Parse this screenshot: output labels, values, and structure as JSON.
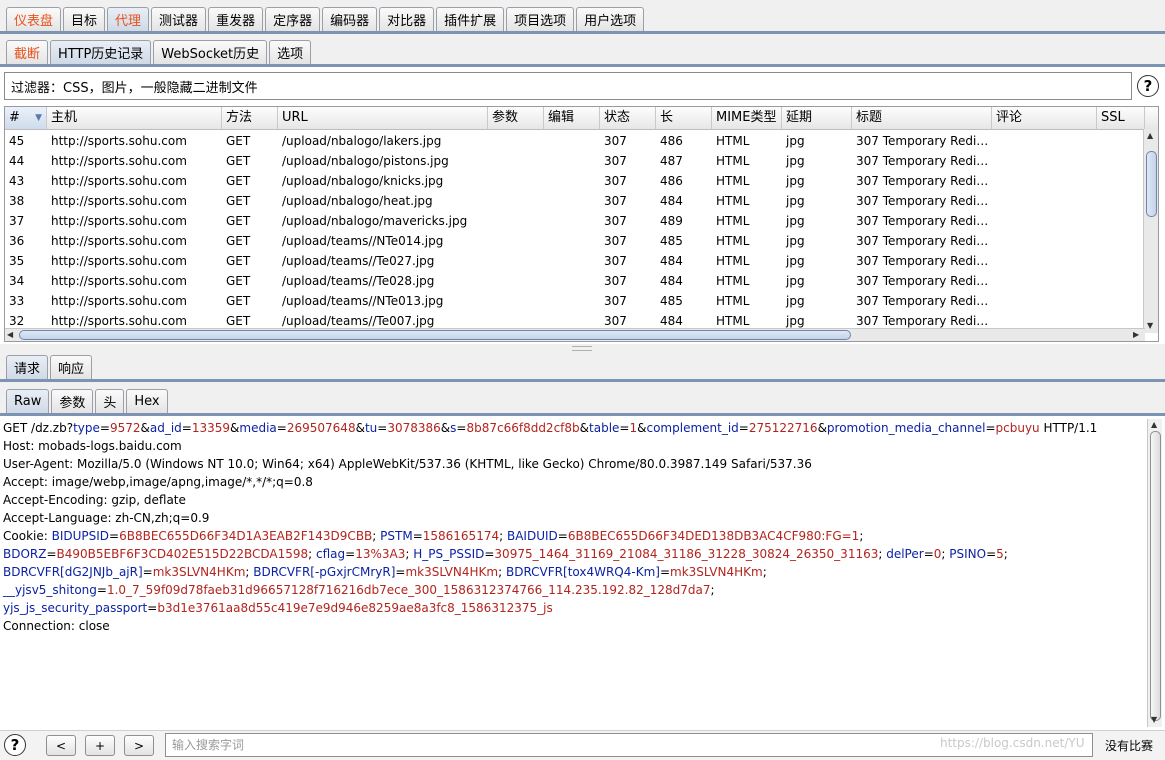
{
  "top_tabs": [
    {
      "label": "仪表盘",
      "style": "orange"
    },
    {
      "label": "目标",
      "style": ""
    },
    {
      "label": "代理",
      "style": "orange active"
    },
    {
      "label": "测试器",
      "style": ""
    },
    {
      "label": "重发器",
      "style": ""
    },
    {
      "label": "定序器",
      "style": ""
    },
    {
      "label": "编码器",
      "style": ""
    },
    {
      "label": "对比器",
      "style": ""
    },
    {
      "label": "插件扩展",
      "style": ""
    },
    {
      "label": "项目选项",
      "style": ""
    },
    {
      "label": "用户选项",
      "style": ""
    }
  ],
  "proxy_tabs": [
    {
      "label": "截断",
      "style": "orange"
    },
    {
      "label": "HTTP历史记录",
      "style": "active"
    },
    {
      "label": "WebSocket历史",
      "style": ""
    },
    {
      "label": "选项",
      "style": ""
    }
  ],
  "filter": {
    "text": "过滤器：CSS，图片，一般隐藏二进制文件"
  },
  "help_symbol": "?",
  "columns": [
    "#",
    "主机",
    "方法",
    "URL",
    "参数",
    "编辑",
    "状态",
    "长",
    "MIME类型",
    "延期",
    "标题",
    "评论",
    "SSL"
  ],
  "sort_arrow": "▼",
  "rows": [
    {
      "num": "45",
      "host": "http://sports.sohu.com",
      "method": "GET",
      "url": "/upload/nbalogo/lakers.jpg",
      "params": "",
      "edited": "",
      "status": "307",
      "length": "486",
      "mime": "HTML",
      "ext": "jpg",
      "title": "307 Temporary Redi…",
      "comment": "",
      "ssl": ""
    },
    {
      "num": "44",
      "host": "http://sports.sohu.com",
      "method": "GET",
      "url": "/upload/nbalogo/pistons.jpg",
      "params": "",
      "edited": "",
      "status": "307",
      "length": "487",
      "mime": "HTML",
      "ext": "jpg",
      "title": "307 Temporary Redi…",
      "comment": "",
      "ssl": ""
    },
    {
      "num": "43",
      "host": "http://sports.sohu.com",
      "method": "GET",
      "url": "/upload/nbalogo/knicks.jpg",
      "params": "",
      "edited": "",
      "status": "307",
      "length": "486",
      "mime": "HTML",
      "ext": "jpg",
      "title": "307 Temporary Redi…",
      "comment": "",
      "ssl": ""
    },
    {
      "num": "38",
      "host": "http://sports.sohu.com",
      "method": "GET",
      "url": "/upload/nbalogo/heat.jpg",
      "params": "",
      "edited": "",
      "status": "307",
      "length": "484",
      "mime": "HTML",
      "ext": "jpg",
      "title": "307 Temporary Redi…",
      "comment": "",
      "ssl": ""
    },
    {
      "num": "37",
      "host": "http://sports.sohu.com",
      "method": "GET",
      "url": "/upload/nbalogo/mavericks.jpg",
      "params": "",
      "edited": "",
      "status": "307",
      "length": "489",
      "mime": "HTML",
      "ext": "jpg",
      "title": "307 Temporary Redi…",
      "comment": "",
      "ssl": ""
    },
    {
      "num": "36",
      "host": "http://sports.sohu.com",
      "method": "GET",
      "url": "/upload/teams//NTe014.jpg",
      "params": "",
      "edited": "",
      "status": "307",
      "length": "485",
      "mime": "HTML",
      "ext": "jpg",
      "title": "307 Temporary Redi…",
      "comment": "",
      "ssl": ""
    },
    {
      "num": "35",
      "host": "http://sports.sohu.com",
      "method": "GET",
      "url": "/upload/teams//Te027.jpg",
      "params": "",
      "edited": "",
      "status": "307",
      "length": "484",
      "mime": "HTML",
      "ext": "jpg",
      "title": "307 Temporary Redi…",
      "comment": "",
      "ssl": ""
    },
    {
      "num": "34",
      "host": "http://sports.sohu.com",
      "method": "GET",
      "url": "/upload/teams//Te028.jpg",
      "params": "",
      "edited": "",
      "status": "307",
      "length": "484",
      "mime": "HTML",
      "ext": "jpg",
      "title": "307 Temporary Redi…",
      "comment": "",
      "ssl": ""
    },
    {
      "num": "33",
      "host": "http://sports.sohu.com",
      "method": "GET",
      "url": "/upload/teams//NTe013.jpg",
      "params": "",
      "edited": "",
      "status": "307",
      "length": "485",
      "mime": "HTML",
      "ext": "jpg",
      "title": "307 Temporary Redi…",
      "comment": "",
      "ssl": ""
    },
    {
      "num": "32",
      "host": "http://sports.sohu.com",
      "method": "GET",
      "url": "/upload/teams//Te007.jpg",
      "params": "",
      "edited": "",
      "status": "307",
      "length": "484",
      "mime": "HTML",
      "ext": "jpg",
      "title": "307 Temporary Redi…",
      "comment": "",
      "ssl": ""
    }
  ],
  "message_tabs": [
    {
      "label": "请求",
      "style": "active"
    },
    {
      "label": "响应",
      "style": ""
    }
  ],
  "view_tabs": [
    {
      "label": "Raw",
      "style": "active"
    },
    {
      "label": "参数",
      "style": ""
    },
    {
      "label": "头",
      "style": ""
    },
    {
      "label": "Hex",
      "style": ""
    }
  ],
  "request_lines": [
    [
      [
        "p",
        "GET /dz.zb?"
      ],
      [
        "k",
        "type"
      ],
      [
        "p",
        "="
      ],
      [
        "v",
        "9572"
      ],
      [
        "p",
        "&"
      ],
      [
        "k",
        "ad_id"
      ],
      [
        "p",
        "="
      ],
      [
        "v",
        "13359"
      ],
      [
        "p",
        "&"
      ],
      [
        "k",
        "media"
      ],
      [
        "p",
        "="
      ],
      [
        "v",
        "269507648"
      ],
      [
        "p",
        "&"
      ],
      [
        "k",
        "tu"
      ],
      [
        "p",
        "="
      ],
      [
        "v",
        "3078386"
      ],
      [
        "p",
        "&"
      ],
      [
        "k",
        "s"
      ],
      [
        "p",
        "="
      ],
      [
        "v",
        "8b87c66f8dd2cf8b"
      ],
      [
        "p",
        "&"
      ],
      [
        "k",
        "table"
      ],
      [
        "p",
        "="
      ],
      [
        "v",
        "1"
      ],
      [
        "p",
        "&"
      ],
      [
        "k",
        "complement_id"
      ],
      [
        "p",
        "="
      ],
      [
        "v",
        "275122716"
      ],
      [
        "p",
        "&"
      ],
      [
        "k",
        "promotion_media_channel"
      ],
      [
        "p",
        "="
      ],
      [
        "v",
        "pcbuyu"
      ],
      [
        "p",
        " HTTP/1.1"
      ]
    ],
    [
      [
        "p",
        "Host: mobads-logs.baidu.com"
      ]
    ],
    [
      [
        "p",
        "User-Agent: Mozilla/5.0 (Windows NT 10.0; Win64; x64) AppleWebKit/537.36 (KHTML, like Gecko) Chrome/80.0.3987.149 Safari/537.36"
      ]
    ],
    [
      [
        "p",
        "Accept: image/webp,image/apng,image/*,*/*;q=0.8"
      ]
    ],
    [
      [
        "p",
        "Accept-Encoding: gzip, deflate"
      ]
    ],
    [
      [
        "p",
        "Accept-Language: zh-CN,zh;q=0.9"
      ]
    ],
    [
      [
        "p",
        "Cookie: "
      ],
      [
        "k",
        "BIDUPSID"
      ],
      [
        "p",
        "="
      ],
      [
        "v",
        "6B8BEC655D66F34D1A3EAB2F143D9CBB"
      ],
      [
        "p",
        "; "
      ],
      [
        "k",
        "PSTM"
      ],
      [
        "p",
        "="
      ],
      [
        "v",
        "1586165174"
      ],
      [
        "p",
        "; "
      ],
      [
        "k",
        "BAIDUID"
      ],
      [
        "p",
        "="
      ],
      [
        "v",
        "6B8BEC655D66F34DED138DB3AC4CF980:FG=1"
      ],
      [
        "p",
        ";"
      ]
    ],
    [
      [
        "k",
        "BDORZ"
      ],
      [
        "p",
        "="
      ],
      [
        "v",
        "B490B5EBF6F3CD402E515D22BCDA1598"
      ],
      [
        "p",
        "; "
      ],
      [
        "k",
        "cflag"
      ],
      [
        "p",
        "="
      ],
      [
        "v",
        "13%3A3"
      ],
      [
        "p",
        "; "
      ],
      [
        "k",
        "H_PS_PSSID"
      ],
      [
        "p",
        "="
      ],
      [
        "v",
        "30975_1464_31169_21084_31186_31228_30824_26350_31163"
      ],
      [
        "p",
        "; "
      ],
      [
        "k",
        "delPer"
      ],
      [
        "p",
        "="
      ],
      [
        "v",
        "0"
      ],
      [
        "p",
        "; "
      ],
      [
        "k",
        "PSINO"
      ],
      [
        "p",
        "="
      ],
      [
        "v",
        "5"
      ],
      [
        "p",
        ";"
      ]
    ],
    [
      [
        "k",
        "BDRCVFR[dG2JNJb_ajR]"
      ],
      [
        "p",
        "="
      ],
      [
        "v",
        "mk3SLVN4HKm"
      ],
      [
        "p",
        "; "
      ],
      [
        "k",
        "BDRCVFR[-pGxjrCMryR]"
      ],
      [
        "p",
        "="
      ],
      [
        "v",
        "mk3SLVN4HKm"
      ],
      [
        "p",
        "; "
      ],
      [
        "k",
        "BDRCVFR[tox4WRQ4-Km]"
      ],
      [
        "p",
        "="
      ],
      [
        "v",
        "mk3SLVN4HKm"
      ],
      [
        "p",
        ";"
      ]
    ],
    [
      [
        "k",
        "__yjsv5_shitong"
      ],
      [
        "p",
        "="
      ],
      [
        "v",
        "1.0_7_59f09d78faeb31d96657128f716216db7ece_300_1586312374766_114.235.192.82_128d7da7"
      ],
      [
        "p",
        ";"
      ]
    ],
    [
      [
        "k",
        "yjs_js_security_passport"
      ],
      [
        "p",
        "="
      ],
      [
        "v",
        "b3d1e3761aa8d55c419e7e9d946e8259ae8a3fc8_1586312375_js"
      ]
    ],
    [
      [
        "p",
        "Connection: close"
      ]
    ]
  ],
  "bottom": {
    "help_symbol": "?",
    "prev_label": "<",
    "add_label": "+",
    "next_label": ">",
    "search_placeholder": "输入搜索字词",
    "watermark": "https://blog.csdn.net/YU",
    "match_status": "没有比赛"
  },
  "colors": {
    "orange": "#e8531d",
    "param_name": "#0b22a6",
    "param_value": "#b3241e",
    "rule": "#7d93b3"
  }
}
